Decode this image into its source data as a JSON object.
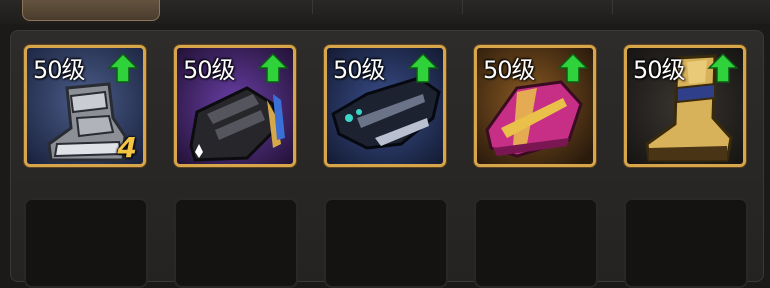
{
  "equipment_slots": [
    {
      "level": "50级",
      "item": "silver-armored-boots",
      "upgrade_available": true,
      "count": "4"
    },
    {
      "level": "50级",
      "item": "black-strap-shoes",
      "upgrade_available": true,
      "count": null
    },
    {
      "level": "50级",
      "item": "dark-serpent-boots",
      "upgrade_available": true,
      "count": null
    },
    {
      "level": "50级",
      "item": "pink-gold-slippers",
      "upgrade_available": true,
      "count": null
    },
    {
      "level": "50级",
      "item": "golden-tall-boots",
      "upgrade_available": true,
      "count": null
    }
  ],
  "empty_slot_count": 5,
  "colors": {
    "slot_border": "#d7a64b",
    "upgrade_arrow": "#2fd23a",
    "count_text": "#f4c542",
    "panel_bg": "#2e2c2a"
  }
}
